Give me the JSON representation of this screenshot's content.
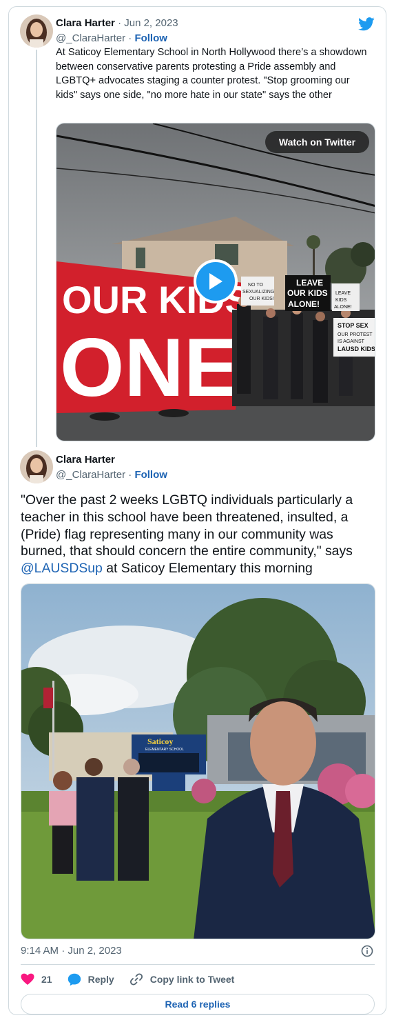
{
  "tweet1": {
    "author_name": "Clara Harter",
    "date": "· Jun 2, 2023",
    "handle": "@_ClaraHarter ·",
    "follow_label": "Follow",
    "text": "At Saticoy Elementary School in North Hollywood there’s a showdown between conservative parents protesting a Pride assembly and LGBTQ+ advocates staging a counter protest. \"Stop grooming our kids\" says one side, \"no more hate in our state\" says the other",
    "video": {
      "watch_label": "Watch on Twitter",
      "banner_text_line1": "OUR KIDS",
      "banner_text_line2": "ONE",
      "signs": [
        "NO TO SEXUALIZING OUR KIDS!",
        "LEAVE OUR KIDS ALONE!",
        "LEAVE KIDS ALONE!",
        "STOP SEXUALIZING OUR PROTEST IS AGAINST LAUSD KIDS!"
      ]
    }
  },
  "tweet2": {
    "author_name": "Clara Harter",
    "handle": "@_ClaraHarter ·",
    "follow_label": "Follow",
    "text_main": "\"Over the past 2 weeks LGBTQ individuals particularly a teacher in this school have been threatened, insulted, a (Pride) flag representing many in our community was burned, that should concern the entire community,\" says",
    "mention": "@LAUSDSup",
    "text_tail": "at Saticoy Elementary this morning",
    "photo": {
      "sign_title": "Saticoy",
      "sign_subtitle": "ELEMENTARY SCHOOL"
    },
    "timestamp": "9:14 AM · Jun 2, 2023"
  },
  "actions": {
    "like_count": "21",
    "reply_label": "Reply",
    "copy_label": "Copy link to Tweet",
    "read_replies_label": "Read 6 replies"
  },
  "colors": {
    "accent": "#1d9bf0",
    "link": "#1d63b3",
    "like": "#f91880",
    "muted": "#536471",
    "border": "#cfd9de"
  },
  "icons": [
    "twitter-bird-icon",
    "heart-icon",
    "reply-bubble-icon",
    "link-icon",
    "info-icon",
    "play-icon"
  ]
}
